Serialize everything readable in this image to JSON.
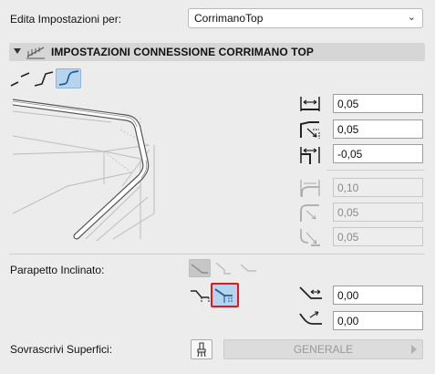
{
  "header": {
    "edit_for_label": "Edita Impostazioni per:",
    "edit_for_value": "CorrimanoTop"
  },
  "section": {
    "title": "IMPOSTAZIONI CONNESSIONE CORRIMANO TOP"
  },
  "connection_fields": {
    "active": [
      "0,05",
      "0,05",
      "-0,05"
    ],
    "disabled": [
      "0,10",
      "0,05",
      "0,05"
    ]
  },
  "slope": {
    "label": "Parapetto Inclinato:",
    "fields": [
      "0,00",
      "0,00"
    ]
  },
  "override": {
    "label": "Sovrascrivi Superfici:",
    "button_label": "GENERALE"
  },
  "colors": {
    "accent_selected": "#b7d4ee",
    "highlight_border": "#e5171d",
    "icon_blue": "#1f5d96"
  }
}
